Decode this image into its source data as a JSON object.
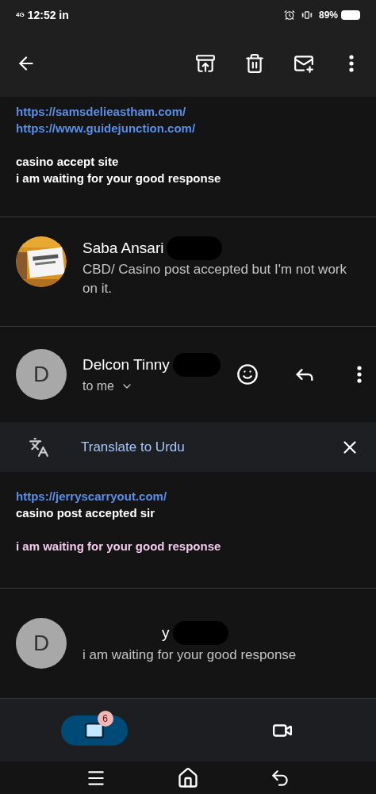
{
  "status_bar": {
    "network": "4G",
    "time": "12:52 in",
    "battery": "89%"
  },
  "top_body": [
    {
      "kind": "link",
      "text": "https://samsdelieastham.com/"
    },
    {
      "kind": "link",
      "text": "https://www.guidejunction.com/"
    },
    {
      "kind": "gap"
    },
    {
      "kind": "text",
      "text": "casino accept site"
    },
    {
      "kind": "text",
      "text": "i am waiting for your good response"
    }
  ],
  "collapsed_message": {
    "sender": "Saba Ansari",
    "snippet": "CBD/ Casino post accepted but I'm not work on it."
  },
  "open_message": {
    "sender": "Delcon Tinny",
    "avatar_letter": "D",
    "recipient": "to me"
  },
  "translate_bar": {
    "label": "Translate to Urdu"
  },
  "open_body": [
    {
      "kind": "link",
      "text": "https://jerryscarryout.com/"
    },
    {
      "kind": "text",
      "text": "casino post accepted sir"
    },
    {
      "kind": "gap"
    },
    {
      "kind": "highlight",
      "text": "i am waiting for your good response"
    }
  ],
  "last_message": {
    "sender": "y",
    "avatar_letter": "D",
    "snippet": "i am waiting for your good response"
  },
  "bottom_nav": [
    {
      "kind": "mail",
      "selected": true,
      "badge": "6"
    },
    {
      "kind": "meet",
      "selected": false
    }
  ]
}
